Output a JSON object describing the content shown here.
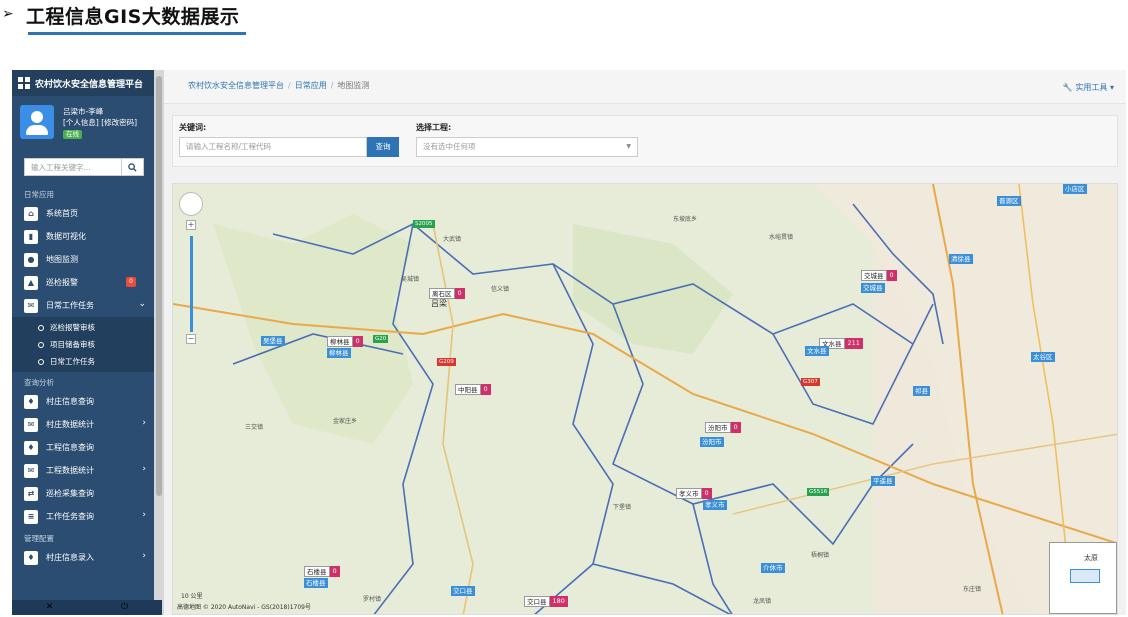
{
  "heading": {
    "arrow": "➢",
    "title": "工程信息GIS大数据展示"
  },
  "sidebar": {
    "app_title": "农村饮水安全信息管理平台",
    "user": {
      "location": "吕梁市-李峰",
      "links": "[个人信息] [修改密码]",
      "status": "在线"
    },
    "search_placeholder": "输入工程关键字...",
    "sections": {
      "daily": "日常应用",
      "query": "查询分析",
      "manage": "管理配置"
    },
    "items": {
      "home": "系统首页",
      "viz": "数据可视化",
      "map": "地图监测",
      "patrol": "巡检报警",
      "patrol_badge": "0",
      "daily_tasks": "日常工作任务",
      "sub1": "巡检报警审核",
      "sub2": "项目储备审核",
      "sub3": "日常工作任务",
      "village_query": "村庄信息查询",
      "village_stats": "村庄数据统计",
      "project_query": "工程信息查询",
      "project_stats": "工程数据统计",
      "patrol_collect": "巡检采集查询",
      "task_query": "工作任务查询",
      "village_entry": "村庄信息录入"
    }
  },
  "breadcrumb": {
    "a": "农村饮水安全信息管理平台",
    "b": "日常应用",
    "c": "地图监测"
  },
  "tools": "实用工具",
  "filter": {
    "kw_label": "关键词:",
    "kw_placeholder": "请输入工程名称/工程代码",
    "search_btn": "查询",
    "proj_label": "选择工程:",
    "proj_value": "没有选中任何项"
  },
  "map": {
    "cities": [
      {
        "name": "离石区",
        "count": "0"
      },
      {
        "name": "交城县",
        "count": "0"
      },
      {
        "name": "柳林县",
        "count": "0"
      },
      {
        "name": "文水县",
        "count": "211"
      },
      {
        "name": "中阳县",
        "count": "0"
      },
      {
        "name": "汾阳市",
        "count": "0"
      },
      {
        "name": "孝义市",
        "count": "0"
      },
      {
        "name": "石楼县",
        "count": "0"
      },
      {
        "name": "交口县",
        "count": "180"
      }
    ],
    "tags": [
      "吕梁",
      "交城县",
      "文水县",
      "柳林县",
      "汾阳市",
      "孝义市",
      "石楼县",
      "交口县",
      "平遥县",
      "祁县",
      "介休市",
      "太谷区",
      "清徐县",
      "小店区",
      "晋源区",
      "吴堡县"
    ],
    "places": [
      "大武镇",
      "东坡底乡",
      "水峪贯镇",
      "吴城镇",
      "信义镇",
      "三交镇",
      "金家庄乡",
      "下堡镇",
      "梧桐镇",
      "龙凤镇",
      "东庄镇",
      "罗村镇",
      "太原"
    ],
    "roads": [
      "S2005",
      "G20",
      "G209",
      "G307",
      "G5516"
    ],
    "scale": "10 公里",
    "attribution": "高德地图 © 2020 AutoNavi - GS(2018)1709号"
  },
  "footer": {
    "left_icon": "expand-icon",
    "right_icon": "power-icon"
  }
}
